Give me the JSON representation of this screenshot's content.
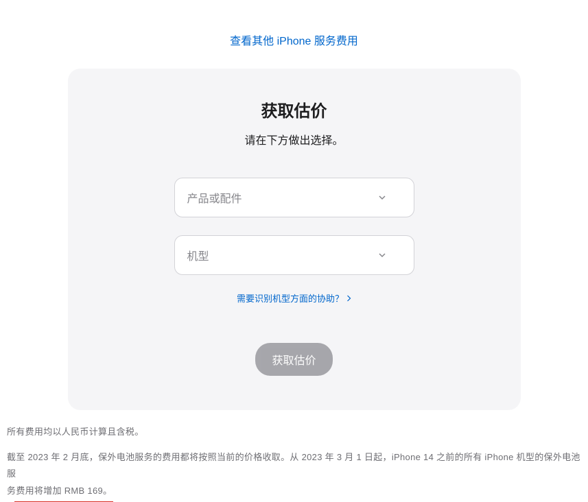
{
  "topLink": {
    "label": "查看其他 iPhone 服务费用"
  },
  "card": {
    "title": "获取估价",
    "subtitle": "请在下方做出选择。",
    "productSelect": {
      "placeholder": "产品或配件"
    },
    "modelSelect": {
      "placeholder": "机型"
    },
    "helpLink": {
      "label": "需要识别机型方面的协助？"
    },
    "button": {
      "label": "获取估价"
    }
  },
  "footer": {
    "line1": "所有费用均以人民币计算且含税。",
    "line2_part1": "截至 2023 年 2 月底，保外电池服务的费用都将按照当前的价格收取。从 2023 年 3 月 1 日起，iPhone 14 之前的所有 iPhone 机型的保外电池服",
    "line2_part2_prefix": "务",
    "line2_highlight": "费用将增加 RMB 169。"
  }
}
